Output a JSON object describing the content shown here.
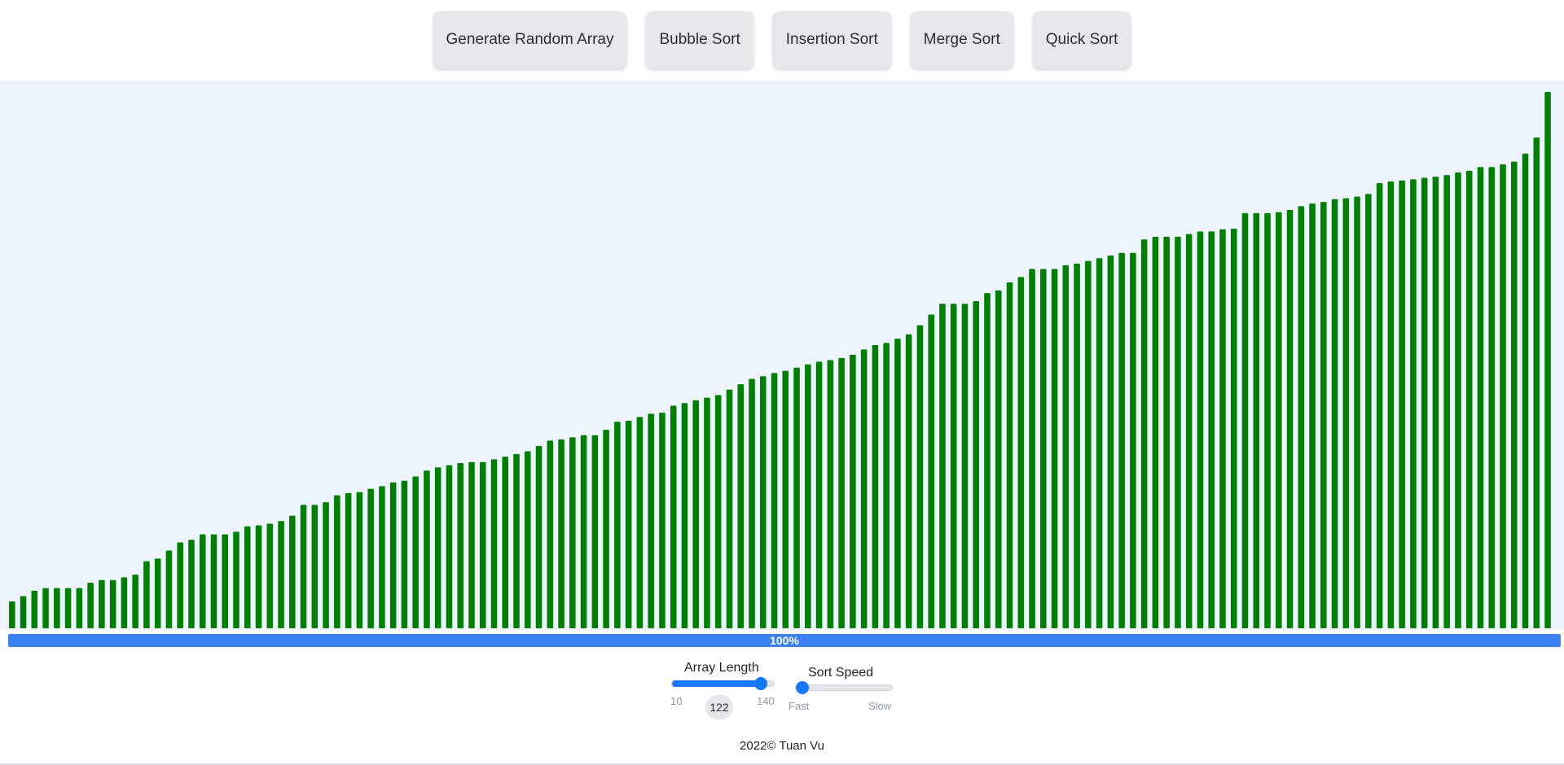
{
  "toolbar": {
    "generate_label": "Generate Random Array",
    "bubble_label": "Bubble Sort",
    "insertion_label": "Insertion Sort",
    "merge_label": "Merge Sort",
    "quick_label": "Quick Sort"
  },
  "chart_data": {
    "type": "bar",
    "bar_color": "#008000",
    "ylim": [
      0,
      100
    ],
    "values": [
      5,
      6,
      7,
      7.5,
      7.5,
      7.5,
      7.5,
      8.5,
      9,
      9,
      9.5,
      10,
      12.5,
      13,
      14.5,
      16,
      16.5,
      17.5,
      17.5,
      17.5,
      18,
      19,
      19.2,
      19.5,
      20,
      21,
      23,
      23,
      23.5,
      24.8,
      25.2,
      25.4,
      26,
      26.5,
      27.2,
      27.5,
      28.3,
      29.4,
      30,
      30.4,
      30.8,
      31,
      31,
      31.5,
      32,
      32.5,
      33,
      34,
      35,
      35.2,
      35.6,
      36,
      36,
      37,
      38.5,
      38.7,
      39.4,
      40,
      40.2,
      41.5,
      42,
      42.5,
      43,
      43.5,
      44.5,
      45.5,
      46.5,
      47,
      47.6,
      48,
      48.6,
      49.2,
      49.7,
      50,
      50.4,
      51,
      52,
      52.8,
      53.2,
      54,
      54.8,
      56.5,
      58.5,
      60.5,
      60.5,
      60.5,
      61,
      62.5,
      63,
      64.5,
      65.5,
      67,
      67,
      67,
      67.7,
      68,
      68.5,
      69,
      69.5,
      70,
      70,
      72.5,
      73,
      73,
      73,
      73.5,
      74,
      74,
      74.4,
      74.5,
      77.4,
      77.4,
      77.4,
      77.6,
      78,
      78.7,
      79.2,
      79.5,
      80,
      80.2,
      80.5,
      81,
      83,
      83.3,
      83.5,
      83.7,
      84,
      84.2,
      84.5,
      85,
      85.3,
      86,
      86,
      86.5,
      87,
      88.5,
      91.5,
      100
    ]
  },
  "progress": {
    "value": 1.0,
    "label": "100%"
  },
  "array_length": {
    "label": "Array Length",
    "min_label": "10",
    "max_label": "140",
    "value_label": "122",
    "min": 10,
    "max": 140,
    "value": 122
  },
  "sort_speed": {
    "label": "Sort Speed",
    "fast_label": "Fast",
    "slow_label": "Slow",
    "value": 0.0
  },
  "footer": {
    "text": "2022© Tuan Vu"
  }
}
